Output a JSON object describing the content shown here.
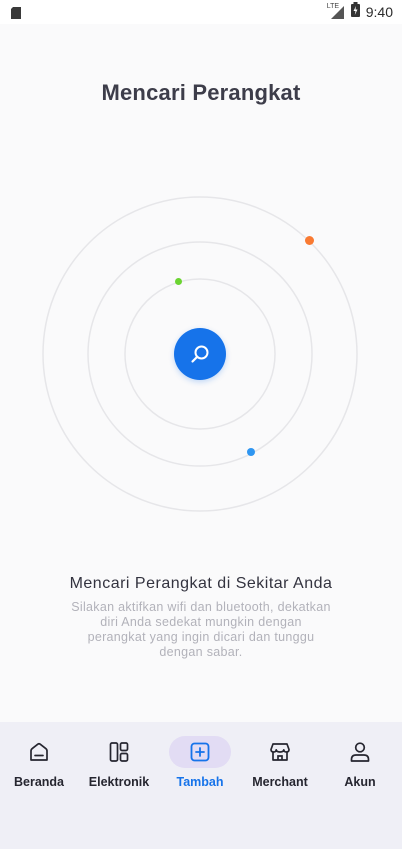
{
  "status_bar": {
    "network": "LTE",
    "time": "9:40"
  },
  "page": {
    "title": "Mencari Perangkat",
    "headline": "Mencari Perangkat di Sekitar Anda",
    "description": "Silakan aktifkan wifi dan bluetooth, dekatkan diri Anda sedekat mungkin dengan perangkat yang ingin dicari dan tunggu dengan sabar."
  },
  "colors": {
    "accent": "#1673ea",
    "dot_orange": "#f97a32",
    "dot_green": "#6bd431",
    "dot_blue": "#2f96f1",
    "nav_background": "#efeff6",
    "active_pill": "#e2dcf4"
  },
  "bottom_nav": {
    "items": [
      {
        "label": "Beranda",
        "icon": "home-icon"
      },
      {
        "label": "Elektronik",
        "icon": "grid-icon"
      },
      {
        "label": "Tambah",
        "icon": "plus-square-icon",
        "active": true
      },
      {
        "label": "Merchant",
        "icon": "store-icon"
      },
      {
        "label": "Akun",
        "icon": "user-icon"
      }
    ]
  }
}
